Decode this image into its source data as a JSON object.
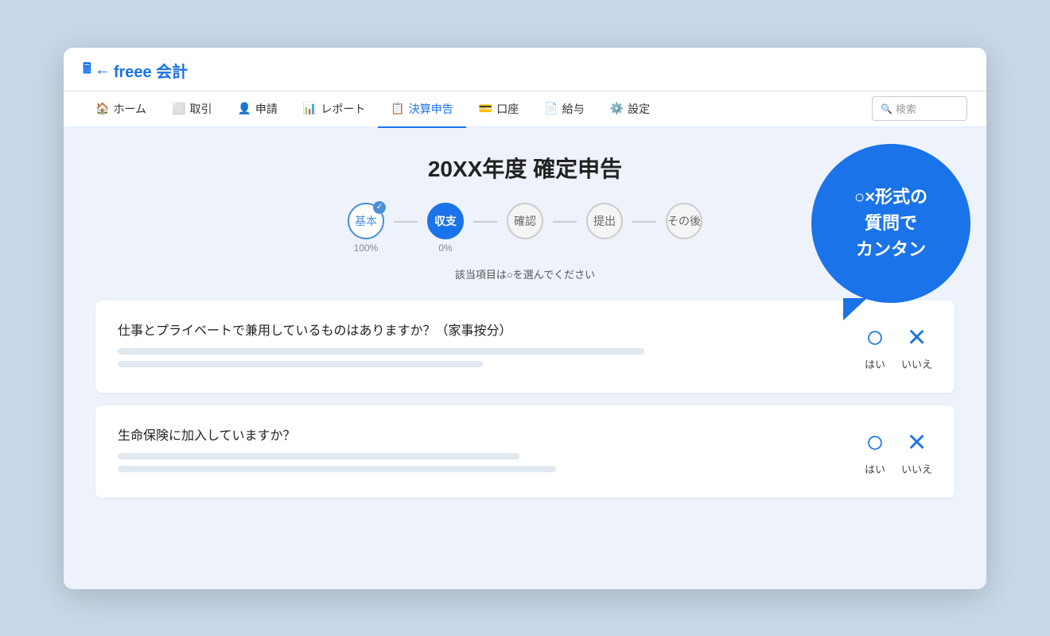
{
  "logo": {
    "icon": "🖩",
    "arrow": "←",
    "brand": "freee 会計"
  },
  "nav": {
    "items": [
      {
        "id": "home",
        "icon": "🏠",
        "label": "ホーム",
        "active": false
      },
      {
        "id": "torihiki",
        "icon": "⬜",
        "label": "取引",
        "active": false
      },
      {
        "id": "shinsei",
        "icon": "👤",
        "label": "申請",
        "active": false
      },
      {
        "id": "report",
        "icon": "📊",
        "label": "レポート",
        "active": false
      },
      {
        "id": "kessanshinko",
        "icon": "📋",
        "label": "決算申告",
        "active": true
      },
      {
        "id": "koza",
        "icon": "💳",
        "label": "口座",
        "active": false
      },
      {
        "id": "kyuyo",
        "icon": "📄",
        "label": "給与",
        "active": false
      },
      {
        "id": "settings",
        "icon": "⚙️",
        "label": "設定",
        "active": false
      }
    ],
    "search_placeholder": "検索"
  },
  "page": {
    "title": "20XX年度 確定申告",
    "stepper": {
      "steps": [
        {
          "id": "kihon",
          "label": "基本",
          "state": "completed",
          "percent": "100%",
          "check": true
        },
        {
          "id": "shushi",
          "label": "収支",
          "state": "active",
          "percent": "0%"
        },
        {
          "id": "kakunin",
          "label": "確認",
          "state": "default",
          "percent": ""
        },
        {
          "id": "teishutsu",
          "label": "提出",
          "state": "default",
          "percent": ""
        },
        {
          "id": "sonogo",
          "label": "その後",
          "state": "default",
          "percent": ""
        }
      ]
    },
    "hint": "該当項目は○を選んでください",
    "questions": [
      {
        "id": "q1",
        "title": "仕事とプライベートで兼用しているものはありますか？（家事按分）",
        "lines": [
          {
            "width": "72%"
          },
          {
            "width": "50%"
          }
        ],
        "answers": [
          {
            "symbol": "○",
            "label": "はい",
            "type": "maru"
          },
          {
            "symbol": "×",
            "label": "いいえ",
            "type": "batsu"
          }
        ]
      },
      {
        "id": "q2",
        "title": "生命保険に加入していますか？",
        "lines": [
          {
            "width": "55%"
          },
          {
            "width": "60%"
          }
        ],
        "answers": [
          {
            "symbol": "○",
            "label": "はい",
            "type": "maru"
          },
          {
            "symbol": "×",
            "label": "いいえ",
            "type": "batsu"
          }
        ]
      }
    ]
  },
  "callout": {
    "line1": "○×形式の",
    "line2": "質問で",
    "line3": "カンタン"
  }
}
